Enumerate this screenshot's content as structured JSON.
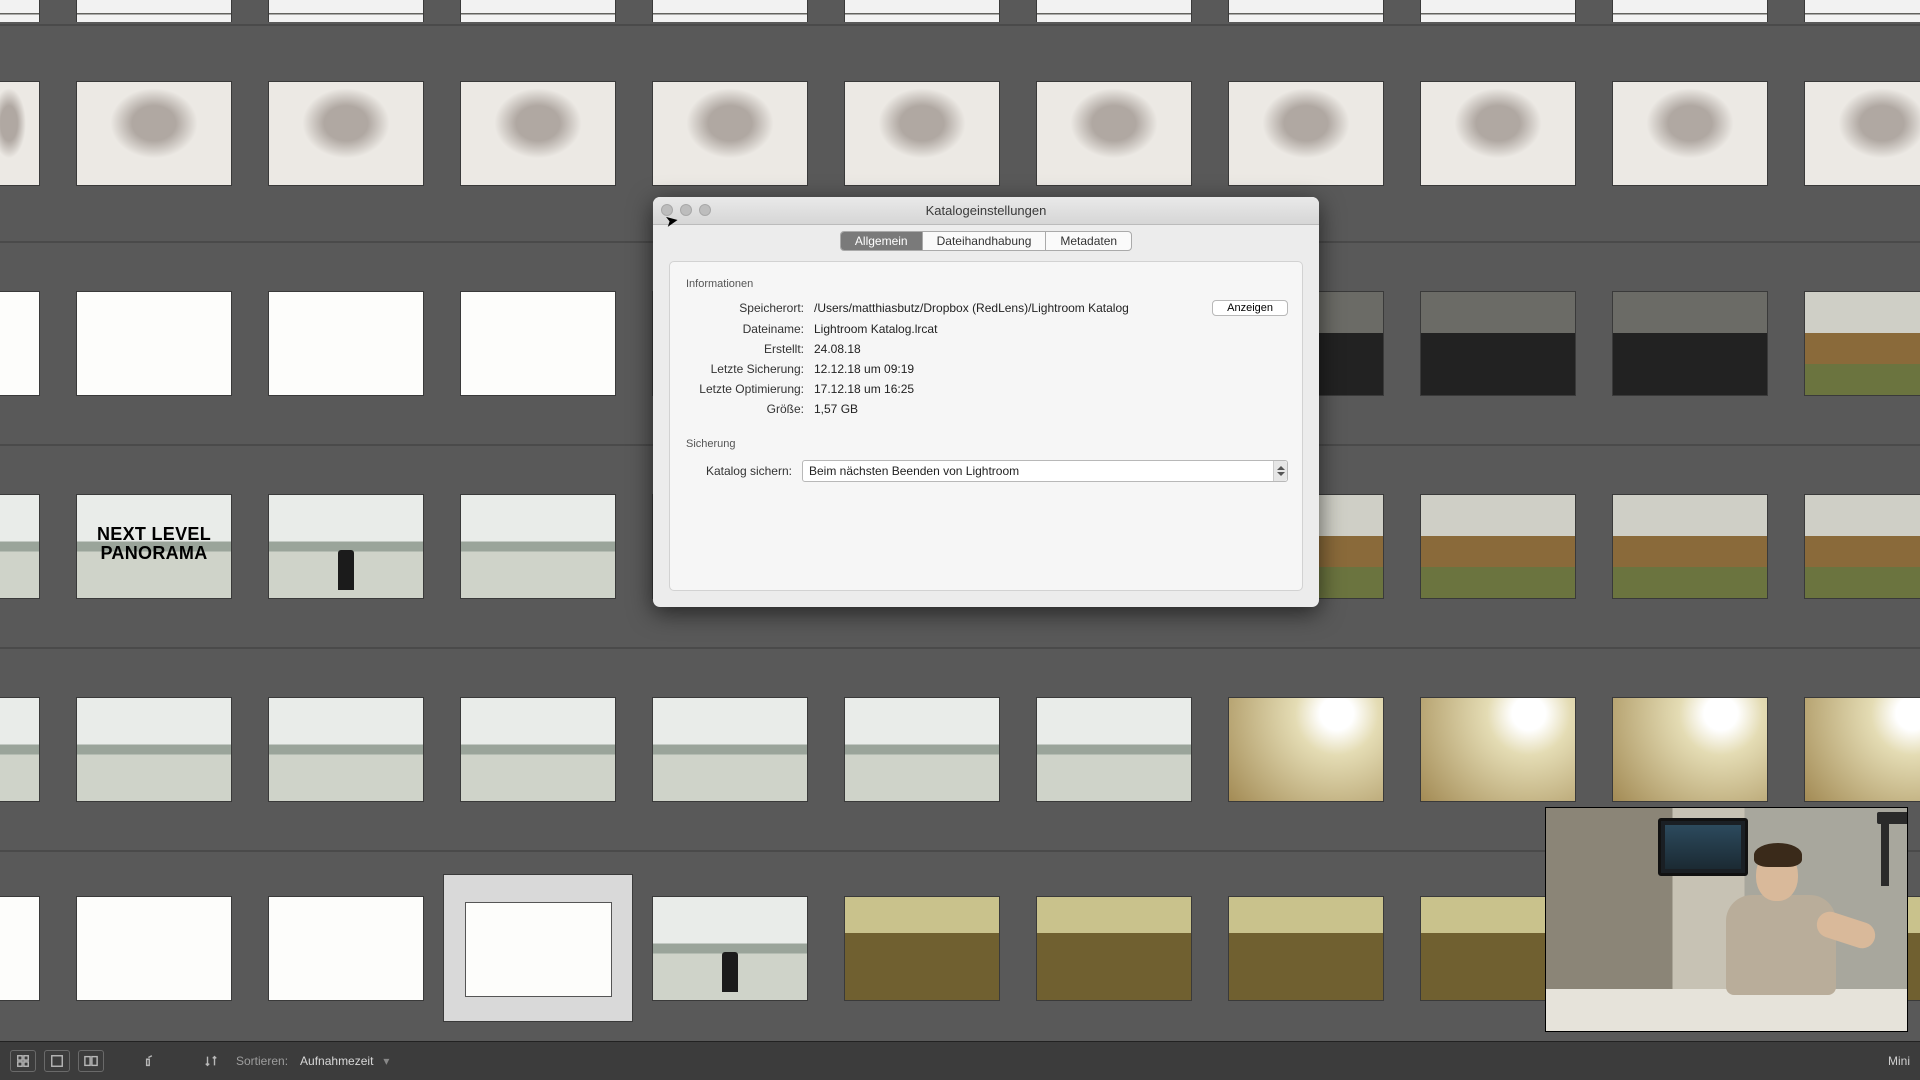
{
  "dialog": {
    "title": "Katalogeinstellungen",
    "tabs": {
      "general": "Allgemein",
      "file": "Dateihandhabung",
      "meta": "Metadaten"
    },
    "info_header": "Informationen",
    "labels": {
      "location": "Speicherort:",
      "filename": "Dateiname:",
      "created": "Erstellt:",
      "lastbackup": "Letzte Sicherung:",
      "lastopt": "Letzte Optimierung:",
      "size": "Größe:",
      "backup_header": "Sicherung",
      "backup_label": "Katalog sichern:"
    },
    "values": {
      "location": "/Users/matthiasbutz/Dropbox (RedLens)/Lightroom Katalog",
      "filename": "Lightroom Katalog.lrcat",
      "created": "24.08.18",
      "lastbackup": "12.12.18 um 09:19",
      "lastopt": "17.12.18 um 16:25",
      "size": "1,57 GB",
      "backup_sel": "Beim nächsten Beenden von Lightroom"
    },
    "show_btn": "Anzeigen"
  },
  "bottom": {
    "sort_label": "Sortieren:",
    "sort_value": "Aufnahmezeit",
    "mini": "Mini"
  },
  "overlay": {
    "nlp_line1": "NEXT LEVEL",
    "nlp_line2": "PANORAMA"
  }
}
